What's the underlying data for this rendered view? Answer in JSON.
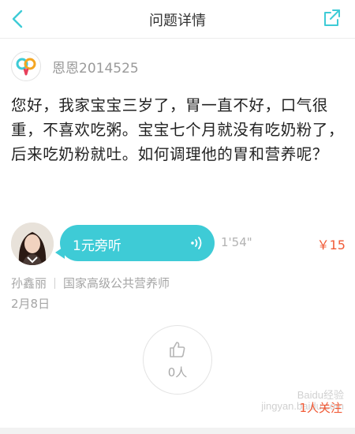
{
  "header": {
    "title": "问题详情",
    "back_icon": "chevron-left-icon",
    "share_icon": "share-icon",
    "accent": "#3ecbd6"
  },
  "asker": {
    "name": "恩恩2014525"
  },
  "question": {
    "text": "您好，我家宝宝三岁了，胃一直不好，口气很重，不喜欢吃粥。宝宝七个月就没有吃奶粉了，后来吃奶粉就吐。如何调理他的胃和营养呢？"
  },
  "answer": {
    "listen_label": "1元旁听",
    "duration": "1'54\"",
    "price": "￥15",
    "expert_name": "孙鑫丽",
    "expert_title": "国家高级公共营养师",
    "date": "2月8日",
    "bubble_color": "#3ecbd6",
    "price_color": "#f15a36"
  },
  "like": {
    "count": "0人"
  },
  "follow": {
    "label": "1人关注"
  },
  "watermark": {
    "line1": "Baidu经验",
    "line2": "jingyan.baidu.com"
  }
}
